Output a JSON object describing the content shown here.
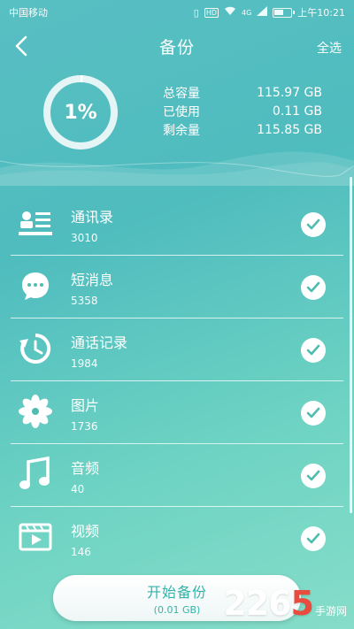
{
  "status_bar": {
    "carrier": "中国移动",
    "network": "4G",
    "time": "上午10:21",
    "hd_badge": "HD"
  },
  "header": {
    "title": "备份",
    "select_all": "全选"
  },
  "storage": {
    "percent_label": "1%",
    "percent_value": 0.01,
    "rows": [
      {
        "label": "总容量",
        "value": "115.97 GB"
      },
      {
        "label": "已使用",
        "value": "0.11 GB"
      },
      {
        "label": "剩余量",
        "value": "115.85 GB"
      }
    ]
  },
  "items": [
    {
      "title": "通讯录",
      "count": "3010",
      "icon": "contacts-icon",
      "checked": true
    },
    {
      "title": "短消息",
      "count": "5358",
      "icon": "message-icon",
      "checked": true
    },
    {
      "title": "通话记录",
      "count": "1984",
      "icon": "call-log-icon",
      "checked": true
    },
    {
      "title": "图片",
      "count": "1736",
      "icon": "picture-icon",
      "checked": true
    },
    {
      "title": "音频",
      "count": "40",
      "icon": "music-icon",
      "checked": true
    },
    {
      "title": "视频",
      "count": "146",
      "icon": "video-icon",
      "checked": true
    }
  ],
  "start_button": {
    "label": "开始备份",
    "size": "(0.01 GB)"
  },
  "watermark": {
    "number_prefix": "226",
    "number_last": "5",
    "text": "手游网"
  },
  "colors": {
    "accent": "#34b3a9",
    "check": "#4fbcb0",
    "watermark_red": "#e94b3c"
  }
}
